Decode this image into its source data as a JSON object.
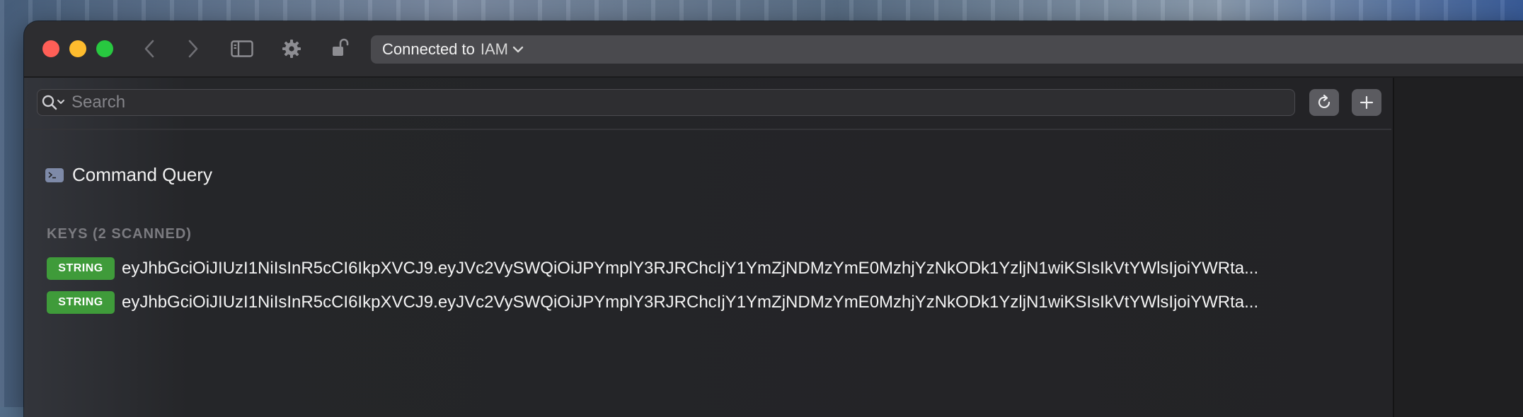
{
  "window": {
    "toolbar": {
      "connection_prefix": "Connected to",
      "connection_db": "IAM"
    },
    "search": {
      "placeholder": "Search"
    },
    "command_query_label": "Command Query",
    "keys_section_title": "KEYS (2 SCANNED)",
    "keys": [
      {
        "type": "STRING",
        "name": "eyJhbGciOiJIUzI1NiIsInR5cCI6IkpXVCJ9.eyJVc2VySWQiOiJPYmplY3RJRChcIjY1YmZjNDMzYmE0MzhjYzNkODk1YzljN1wiKSIsIkVtYWlsIjoiYWRta..."
      },
      {
        "type": "STRING",
        "name": "eyJhbGciOiJIUzI1NiIsInR5cCI6IkpXVCJ9.eyJVc2VySWQiOiJPYmplY3RJRChcIjY1YmZjNDMzYmE0MzhjYzNkODk1YzljN1wiKSIsIkVtYWlsIjoiYWRta..."
      }
    ]
  },
  "colors": {
    "badge_string": "#3f9b3a",
    "traffic_close": "#ff5f57",
    "traffic_minimize": "#febc2e",
    "traffic_maximize": "#28c840"
  }
}
